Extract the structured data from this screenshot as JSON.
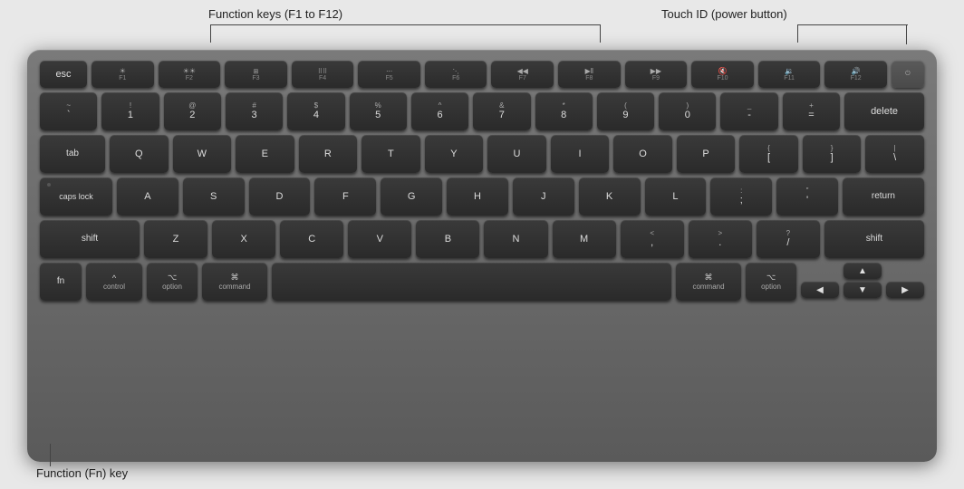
{
  "annotations": {
    "function_keys_label": "Function keys (F1 to F12)",
    "touch_id_label": "Touch ID (power button)",
    "fn_key_label": "Function (Fn) key"
  },
  "keyboard": {
    "rows": {
      "fn_row": [
        "esc",
        "F1",
        "F2",
        "F3",
        "F4",
        "F5",
        "F6",
        "F7",
        "F8",
        "F9",
        "F10",
        "F11",
        "F12",
        "TouchID"
      ],
      "number_row": [
        "~`",
        "!1",
        "@2",
        "#3",
        "$4",
        "%5",
        "^6",
        "&7",
        "*8",
        "(9",
        ")0",
        "-",
        "=",
        "delete"
      ],
      "tab_row": [
        "tab",
        "Q",
        "W",
        "E",
        "R",
        "T",
        "Y",
        "U",
        "I",
        "O",
        "P",
        "[{",
        "]}",
        "\\|"
      ],
      "caps_row": [
        "caps lock",
        "A",
        "S",
        "D",
        "F",
        "G",
        "H",
        "J",
        "K",
        "L",
        ";:",
        "'\"",
        "return"
      ],
      "shift_row": [
        "shift",
        "Z",
        "X",
        "C",
        "V",
        "B",
        "N",
        "M",
        ",<",
        ".>",
        "/?",
        "shift"
      ],
      "bottom_row": [
        "fn",
        "control",
        "option",
        "command",
        "space",
        "command",
        "option",
        "arrows"
      ]
    }
  }
}
